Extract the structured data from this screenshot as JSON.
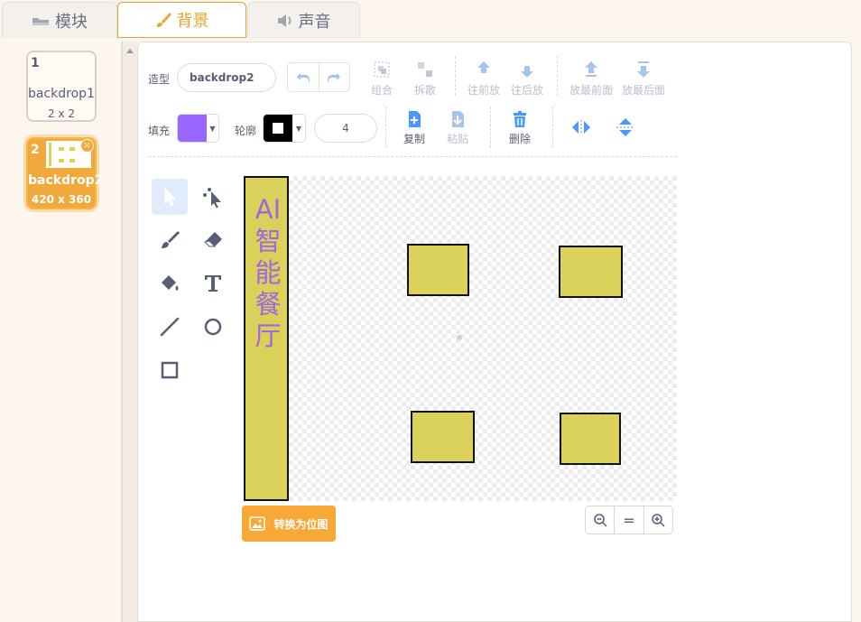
{
  "tabs": [
    {
      "label": "模块",
      "icon": "blocks-icon"
    },
    {
      "label": "背景",
      "icon": "brush-icon"
    },
    {
      "label": "声音",
      "icon": "speaker-icon"
    }
  ],
  "backdrops": [
    {
      "number": "1",
      "name": "backdrop1",
      "size": "2 x 2"
    },
    {
      "number": "2",
      "name": "backdrop2",
      "size": "420 x 360"
    }
  ],
  "toolbar": {
    "costume_label": "造型",
    "costume_name": "backdrop2",
    "group": "组合",
    "ungroup": "拆散",
    "forward": "往前放",
    "backward": "往后放",
    "front": "放最前面",
    "back": "放最后面",
    "fill_label": "填充",
    "fill_color": "#9966ff",
    "outline_label": "轮廓",
    "outline_color": "#000000",
    "outline_width": "4",
    "copy": "复制",
    "paste": "粘贴",
    "delete": "删除"
  },
  "canvas": {
    "text_lines": [
      "AI",
      "智",
      "能",
      "餐",
      "厅"
    ],
    "shape_color": "#dad15a",
    "text_color": "#a066e0"
  },
  "convert_label": "转换为位图",
  "zoom": {
    "out": "-",
    "reset": "=",
    "in": "+"
  }
}
